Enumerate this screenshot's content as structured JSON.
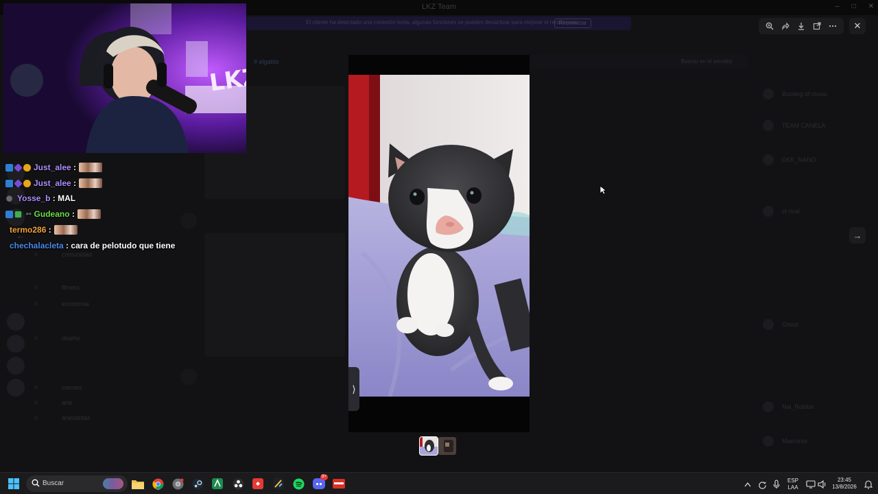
{
  "window": {
    "title": "LKZ Team",
    "minimize": "–",
    "maximize": "□",
    "close": "✕"
  },
  "banner": {
    "text": "El cliente ha detectado una conexión lenta, algunas funciones se pueden desactivar para mejorar el rendimiento",
    "button": "Reconectar"
  },
  "discord_ghost": {
    "channel_tab": "# elgatito",
    "member_search": "Buscar en el servidor",
    "channels": [
      "comunidad",
      "fitness",
      "economía",
      "diseño",
      "memes",
      "arte",
      "anécdotas"
    ],
    "members": [
      "Bootleg of music",
      "TEAM CANELA",
      "DKK_NANO",
      "el rival",
      "Ghost",
      "Nai_Roblox",
      "Maestrito"
    ]
  },
  "viewer": {
    "toolbar": [
      "zoom-in-icon",
      "share-icon",
      "download-icon",
      "open-external-icon",
      "more-icon"
    ],
    "close_glyph": "✕",
    "next_glyph": "→",
    "prev_glyph": "←",
    "side_tab_glyph": "⟩",
    "image_subject": "kitten"
  },
  "stream_chat": [
    {
      "badges": [
        "prime",
        "sub",
        "gold"
      ],
      "user": "Just_alee",
      "color": "purple",
      "message": "",
      "emote": true
    },
    {
      "badges": [
        "prime",
        "sub",
        "gold"
      ],
      "user": "Just_alee",
      "color": "purple",
      "message": "",
      "emote": true
    },
    {
      "badges": [
        "bot"
      ],
      "user": "Yosse_b",
      "color": "purple",
      "message": "MAL",
      "emote": false
    },
    {
      "badges": [
        "prime",
        "green",
        "mod"
      ],
      "user": "Gudeano",
      "color": "green",
      "message": "",
      "emote": true
    },
    {
      "badges": [],
      "user": "termo286",
      "color": "orange",
      "message": "",
      "emote": true
    },
    {
      "badges": [],
      "user": "chechalacleta",
      "color": "blue",
      "message": "cara de pelotudo que tiene",
      "emote": false
    }
  ],
  "taskbar": {
    "search_placeholder": "Buscar",
    "apps": [
      "windows-start-icon",
      "file-explorer-icon",
      "chrome-icon",
      "chrome-dev-icon",
      "steam-icon",
      "android-studio-icon",
      "obs-icon",
      "action-icon",
      "app-icon",
      "spotify-icon",
      "discord-icon",
      "kiosk-icon"
    ],
    "discord_badge": "9+",
    "lang_top": "ESP",
    "lang_bottom": "LAA",
    "time": "23:45",
    "date": "13/8/2026"
  },
  "colors": {
    "accent": "#5865f2",
    "overlay": "#0b0b0c",
    "chat_purple": "#b18cff",
    "chat_green": "#6ddc4a",
    "chat_orange": "#f2a33a",
    "chat_blue": "#4a8bea"
  }
}
